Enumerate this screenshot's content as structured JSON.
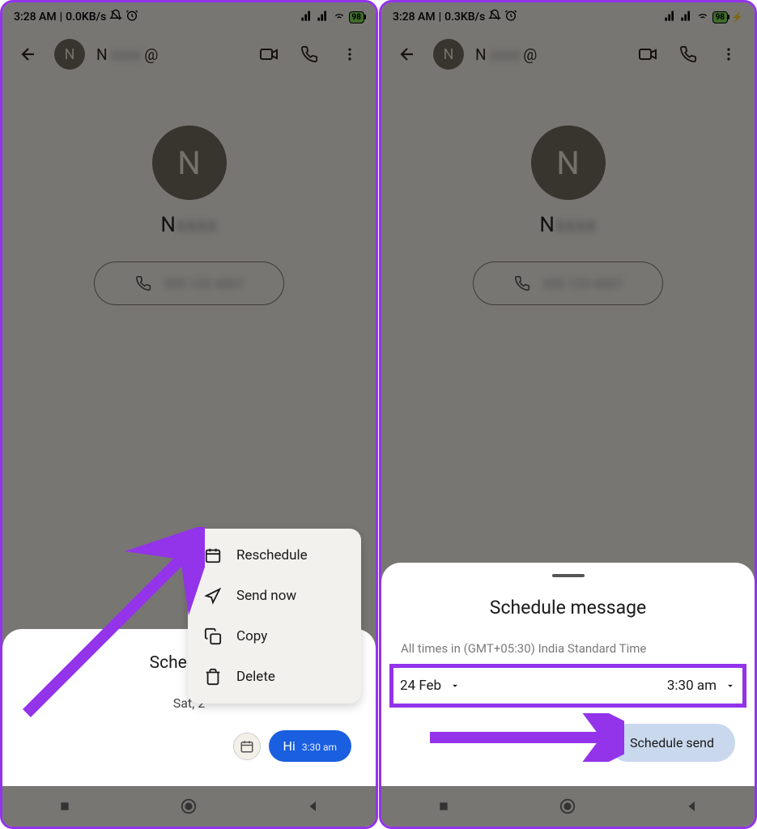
{
  "left": {
    "status": {
      "time": "3:28 AM",
      "speed": "0.0KB/s",
      "battery": "98"
    },
    "topbar": {
      "initial": "N",
      "name": "N"
    },
    "contact": {
      "initial": "N",
      "name": "N"
    },
    "sheet": {
      "title": "Scheduled",
      "date": "Sat, 2"
    },
    "bubble": {
      "text": "Hi",
      "time": "3:30 am"
    },
    "menu": {
      "reschedule": "Reschedule",
      "send_now": "Send now",
      "copy": "Copy",
      "delete": "Delete"
    }
  },
  "right": {
    "status": {
      "time": "3:28 AM",
      "speed": "0.3KB/s",
      "battery": "98"
    },
    "topbar": {
      "initial": "N",
      "name": "N"
    },
    "contact": {
      "initial": "N",
      "name": "N"
    },
    "schedule": {
      "title": "Schedule message",
      "timezone": "All times in (GMT+05:30) India Standard Time",
      "date": "24 Feb",
      "time": "3:30 am",
      "button": "Schedule send"
    }
  }
}
